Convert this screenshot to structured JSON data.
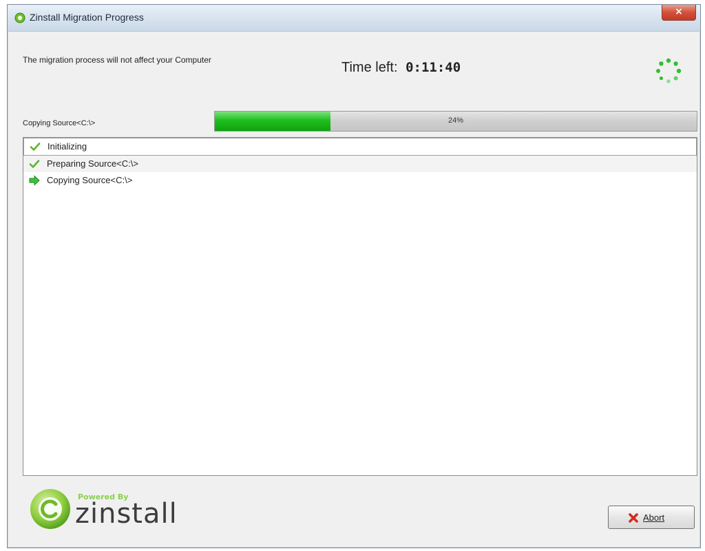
{
  "window": {
    "title": "Zinstall Migration Progress",
    "close_glyph": "×"
  },
  "header": {
    "info_text": "The migration process will not affect your Computer",
    "time_left_label": "Time left:",
    "time_left_value": "0:11:40"
  },
  "progress": {
    "label": "Copying Source<C:\\>",
    "percent_text": "24%",
    "value": 0.24,
    "color": "#1fbf1f"
  },
  "steps": [
    {
      "label": "Initializing",
      "status": "done",
      "icon": "check-icon"
    },
    {
      "label": "Preparing Source<C:\\>",
      "status": "done",
      "icon": "check-icon"
    },
    {
      "label": "Copying Source<C:\\>",
      "status": "in-progress",
      "icon": "arrow-right-icon"
    }
  ],
  "footer": {
    "logo_powered": "Powered By",
    "logo_name": "zinstall",
    "abort_label": "Abort"
  },
  "colors": {
    "accent_green": "#1fbf1f",
    "logo_green": "#8ad14b",
    "close_red": "#d2503a"
  }
}
